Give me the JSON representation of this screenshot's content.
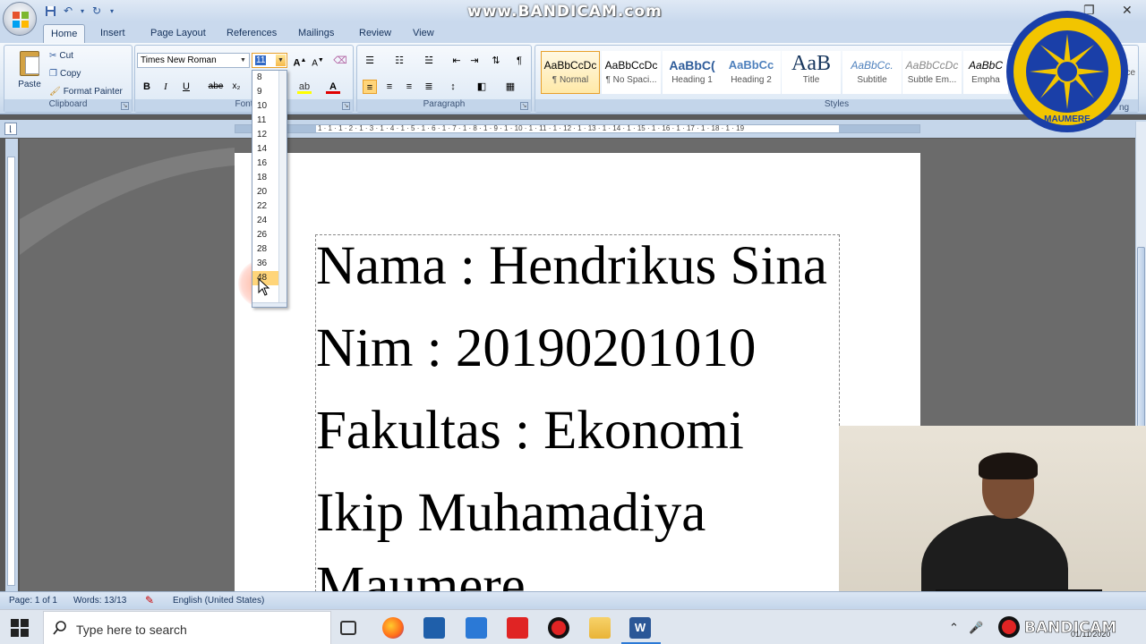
{
  "overlay": {
    "bandicam_top": "www.BANDICAM.com",
    "bandicam_bottom": "BANDICAM",
    "clock_partial": "01/11/2020"
  },
  "tabs": [
    "Home",
    "Insert",
    "Page Layout",
    "References",
    "Mailings",
    "Review",
    "View"
  ],
  "clipboard": {
    "paste": "Paste",
    "cut": "Cut",
    "copy": "Copy",
    "format_painter": "Format Painter",
    "group": "Clipboard"
  },
  "font": {
    "name": "Times New Roman",
    "size": "11",
    "group": "Font",
    "buttons": [
      "B",
      "I",
      "U",
      "abe",
      "x₂"
    ]
  },
  "font_size_options": [
    "8",
    "9",
    "10",
    "11",
    "12",
    "14",
    "16",
    "18",
    "20",
    "22",
    "24",
    "26",
    "28",
    "36",
    "48"
  ],
  "paragraph": {
    "group": "Paragraph"
  },
  "styles": {
    "group": "Styles",
    "items": [
      {
        "sample": "AaBbCcDc",
        "name": "¶ Normal"
      },
      {
        "sample": "AaBbCcDc",
        "name": "¶ No Spaci..."
      },
      {
        "sample": "AaBbC(",
        "name": "Heading 1"
      },
      {
        "sample": "AaBbCc",
        "name": "Heading 2"
      },
      {
        "sample": "AaB",
        "name": "Title"
      },
      {
        "sample": "AaBbCc.",
        "name": "Subtitle"
      },
      {
        "sample": "AaBbCcDc",
        "name": "Subtle Em..."
      },
      {
        "sample": "AaBbC",
        "name": "Empha"
      }
    ],
    "partial_right": "nce",
    "partial_label": "ng"
  },
  "ruler_numbers": "1 · 1 · 1 · 2 · 1 · 3 · 1 · 4 · 1 · 5 · 1 · 6 · 1 · 7 · 1 · 8 · 1 · 9 · 1 · 10 · 1 · 11 · 1 · 12 · 1 · 13 · 1 · 14 · 1 · 15 · 1 · 16 · 1 · 17 · 1 · 18 · 1 · 19",
  "document": {
    "lines": [
      "Nama : Hendrikus Sina",
      "Nim : 20190201010",
      "Fakultas : Ekonomi",
      "Ikip Muhamadiya",
      "Maumere"
    ]
  },
  "seal": {
    "text": "INSTITUT KEGURUAN DAN ILMU PENDIDIKAN MUHAMMADIYAH",
    "bottom": "MAUMERE"
  },
  "status": {
    "page": "Page: 1 of 1",
    "words": "Words: 13/13",
    "language": "English (United States)"
  },
  "taskbar": {
    "search_placeholder": "Type here to search"
  }
}
